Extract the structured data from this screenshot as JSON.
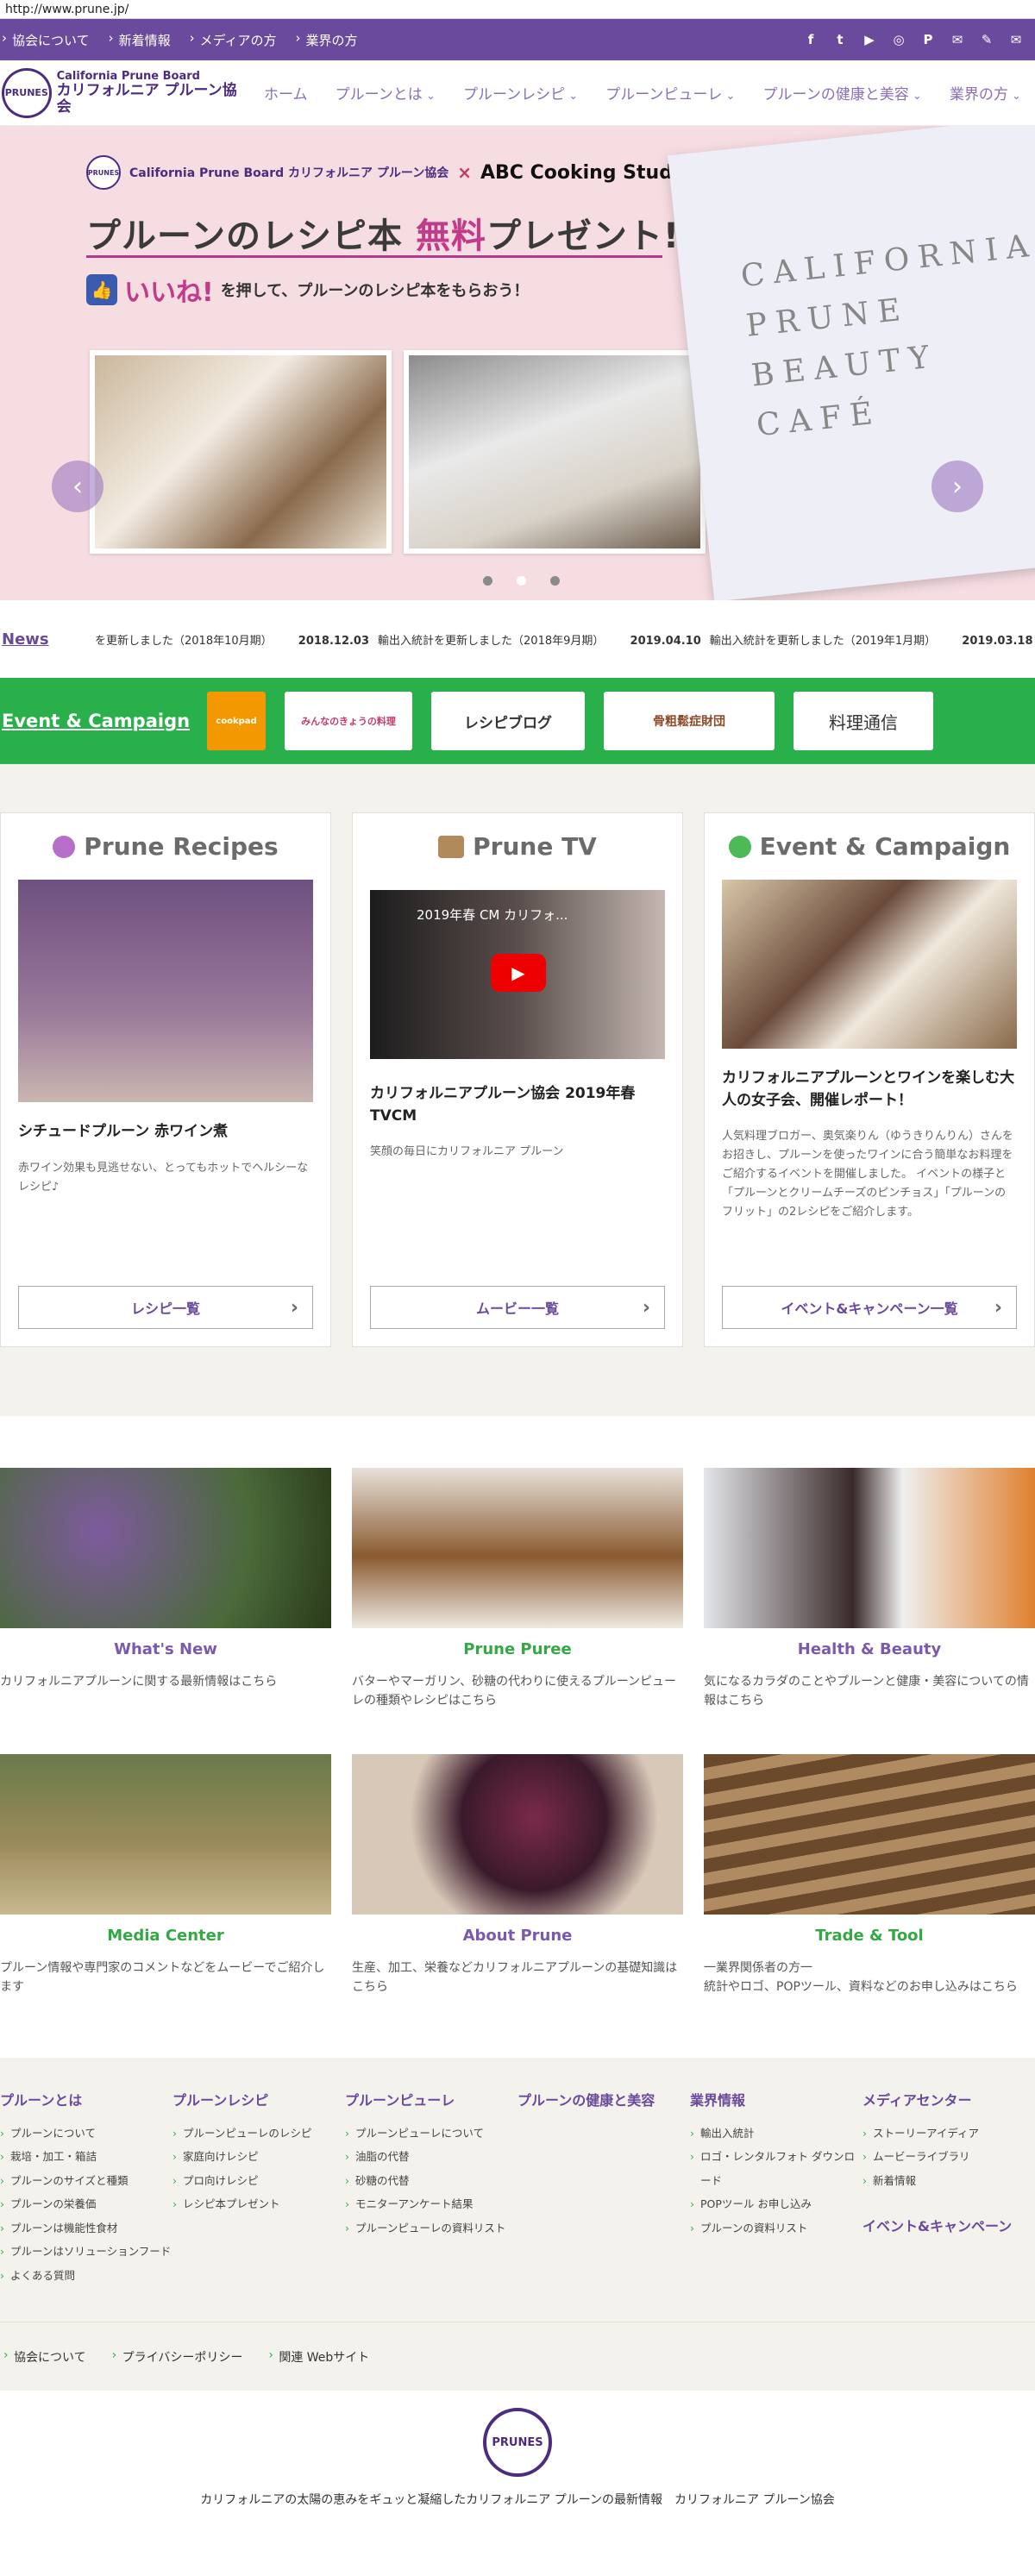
{
  "url": "http://www.prune.jp/",
  "topbar": {
    "links": [
      "協会について",
      "新着情報",
      "メディアの方",
      "業界の方"
    ],
    "social_icons": [
      "facebook-icon",
      "twitter-icon",
      "youtube-icon",
      "instagram-icon",
      "pinterest-icon",
      "line-icon",
      "pen-icon",
      "mail-icon"
    ]
  },
  "logo": {
    "en": "California Prune Board",
    "jp": "カリフォルニア プルーン協会",
    "mark": "PRUNES"
  },
  "nav": [
    "ホーム",
    "プルーンとは",
    "プルーンレシピ",
    "プルーンピューレ",
    "プルーンの健康と美容",
    "業界の方"
  ],
  "hero": {
    "brand": "California Prune Board カリフォルニア プルーン協会",
    "x": "×",
    "partner": "ABC Cooking Studio",
    "title_a": "プルーンのレシピ本 ",
    "title_free": "無料",
    "title_b": "プレゼント!",
    "like_word": "いいね!",
    "like_text": "を押して、プルーンのレシピ本をもらおう！",
    "book_text": "CALIFORNIA PRUNE BEAUTY CAFÉ"
  },
  "news": {
    "label": "News",
    "items": [
      {
        "date": "",
        "text": "を更新しました（2018年10月期）"
      },
      {
        "date": "2018.12.03",
        "text": "輸出入統計を更新しました（2018年9月期）"
      },
      {
        "date": "2019.04.10",
        "text": "輸出入統計を更新しました（2019年1月期）"
      },
      {
        "date": "2019.03.18",
        "text": ""
      }
    ]
  },
  "event_bar": {
    "title": "Event & Campaign",
    "banners": [
      "cookpad",
      "みんなのきょうの料理",
      "レシピブログ",
      "骨粗鬆症財団",
      "料理通信"
    ]
  },
  "cards": [
    {
      "title": "Prune Recipes",
      "headline": "シチュードプルーン 赤ワイン煮",
      "body": "赤ワイン効果も見逃せない、とってもホットでヘルシーなレシピ♪",
      "button": "レシピ一覧"
    },
    {
      "title": "Prune TV",
      "headline": "カリフォルニアプルーン協会 2019年春TVCM",
      "body": "笑顔の毎日にカリフォルニア プルーン",
      "button": "ムービー一覧",
      "video_title": "2019年春 CM カリフォ..."
    },
    {
      "title": "Event & Campaign",
      "headline": "カリフォルニアプルーンとワインを楽しむ大人の女子会、開催レポート！",
      "body": "人気料理ブロガー、奥気楽りん（ゆうきりんりん）さんをお招きし、プルーンを使ったワインに合う簡単なお料理をご紹介するイベントを開催しました。 イベントの様子と「プルーンとクリームチーズのピンチョス」「プルーンのフリット」の2レシピをご紹介します。",
      "button": "イベント&キャンペーン一覧"
    }
  ],
  "tiles": [
    {
      "title": "What's New",
      "desc": "カリフォルニアプルーンに関する最新情報はこちら"
    },
    {
      "title": "Prune Puree",
      "desc": "バターやマーガリン、砂糖の代わりに使えるプルーンピューレの種類やレシピはこちら"
    },
    {
      "title": "Health & Beauty",
      "desc": "気になるカラダのことやプルーンと健康・美容についての情報はこちら"
    },
    {
      "title": "Media Center",
      "desc": "プルーン情報や専門家のコメントなどをムービーでご紹介します"
    },
    {
      "title": "About Prune",
      "desc": "生産、加工、栄養などカリフォルニアプルーンの基礎知識はこちら"
    },
    {
      "title": "Trade & Tool",
      "desc": "一業界関係者の方一\n統計やロゴ、POPツール、資料などのお申し込みはこちら"
    }
  ],
  "footer": {
    "cols": [
      {
        "title": "プルーンとは",
        "items": [
          "プルーンについて",
          "栽培・加工・箱詰",
          "プルーンのサイズと種類",
          "プルーンの栄養価",
          "プルーンは機能性食材",
          "プルーンはソリューションフード",
          "よくある質問"
        ]
      },
      {
        "title": "プルーンレシピ",
        "items": [
          "プルーンピューレのレシピ",
          "家庭向けレシピ",
          "プロ向けレシピ",
          "レシピ本プレゼント"
        ]
      },
      {
        "title": "プルーンピューレ",
        "items": [
          "プルーンピューレについて",
          "油脂の代替",
          "砂糖の代替",
          "モニターアンケート結果",
          "プルーンピューレの資料リスト"
        ]
      },
      {
        "title": "プルーンの健康と美容",
        "items": []
      },
      {
        "title": "業界情報",
        "items": [
          "輸出入統計",
          "ロゴ・レンタルフォト ダウンロード",
          "POPツール お申し込み",
          "プルーンの資料リスト"
        ]
      },
      {
        "title": "メディアセンター",
        "items": [
          "ストーリーアイディア",
          "ムービーライブラリ",
          "新着情報"
        ],
        "second_title": "イベント&キャンペーン"
      }
    ],
    "sub_links": [
      "協会について",
      "プライバシーポリシー",
      "関連 Webサイト"
    ],
    "logo_mark": "PRUNES",
    "tagline": "カリフォルニアの太陽の恵みをギュッと凝縮したカリフォルニア プルーンの最新情報　カリフォルニア プルーン協会"
  }
}
